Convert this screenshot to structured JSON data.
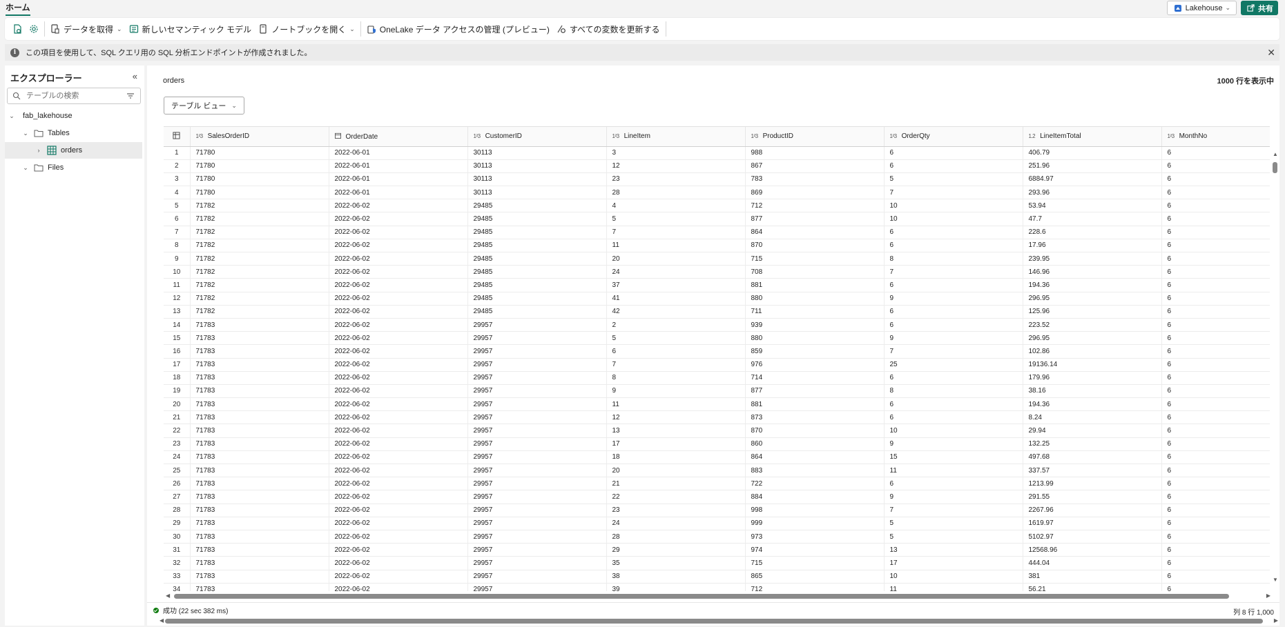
{
  "topbar": {
    "home_tab": "ホーム",
    "lakehouse_label": "Lakehouse",
    "share_label": "共有"
  },
  "ribbon": {
    "get_data": "データを取得",
    "new_semantic_model": "新しいセマンティック モデル",
    "open_notebook": "ノートブックを開く",
    "onelake_access": "OneLake データ アクセスの管理 (プレビュー)",
    "refresh_variables": "すべての変数を更新する"
  },
  "infobar": {
    "message": "この項目を使用して、SQL クエリ用の SQL 分析エンドポイントが作成されました。"
  },
  "explorer": {
    "title": "エクスプローラー",
    "search_placeholder": "テーブルの検索",
    "lakehouse": "fab_lakehouse",
    "tables_folder": "Tables",
    "table": "orders",
    "files_folder": "Files"
  },
  "main": {
    "table_name": "orders",
    "row_count": "1000 行を表示中",
    "view_button": "テーブル ビュー",
    "columns": [
      {
        "type": "1²3",
        "name": "SalesOrderID"
      },
      {
        "type": "date",
        "name": "OrderDate"
      },
      {
        "type": "1²3",
        "name": "CustomerID"
      },
      {
        "type": "1²3",
        "name": "LineItem"
      },
      {
        "type": "1²3",
        "name": "ProductID"
      },
      {
        "type": "1²3",
        "name": "OrderQty"
      },
      {
        "type": "1.2",
        "name": "LineItemTotal"
      },
      {
        "type": "1²3",
        "name": "MonthNo"
      }
    ],
    "rows": [
      [
        "1",
        "71780",
        "2022-06-01",
        "30113",
        "3",
        "988",
        "6",
        "406.79",
        "6"
      ],
      [
        "2",
        "71780",
        "2022-06-01",
        "30113",
        "12",
        "867",
        "6",
        "251.96",
        "6"
      ],
      [
        "3",
        "71780",
        "2022-06-01",
        "30113",
        "23",
        "783",
        "5",
        "6884.97",
        "6"
      ],
      [
        "4",
        "71780",
        "2022-06-01",
        "30113",
        "28",
        "869",
        "7",
        "293.96",
        "6"
      ],
      [
        "5",
        "71782",
        "2022-06-02",
        "29485",
        "4",
        "712",
        "10",
        "53.94",
        "6"
      ],
      [
        "6",
        "71782",
        "2022-06-02",
        "29485",
        "5",
        "877",
        "10",
        "47.7",
        "6"
      ],
      [
        "7",
        "71782",
        "2022-06-02",
        "29485",
        "7",
        "864",
        "6",
        "228.6",
        "6"
      ],
      [
        "8",
        "71782",
        "2022-06-02",
        "29485",
        "11",
        "870",
        "6",
        "17.96",
        "6"
      ],
      [
        "9",
        "71782",
        "2022-06-02",
        "29485",
        "20",
        "715",
        "8",
        "239.95",
        "6"
      ],
      [
        "10",
        "71782",
        "2022-06-02",
        "29485",
        "24",
        "708",
        "7",
        "146.96",
        "6"
      ],
      [
        "11",
        "71782",
        "2022-06-02",
        "29485",
        "37",
        "881",
        "6",
        "194.36",
        "6"
      ],
      [
        "12",
        "71782",
        "2022-06-02",
        "29485",
        "41",
        "880",
        "9",
        "296.95",
        "6"
      ],
      [
        "13",
        "71782",
        "2022-06-02",
        "29485",
        "42",
        "711",
        "6",
        "125.96",
        "6"
      ],
      [
        "14",
        "71783",
        "2022-06-02",
        "29957",
        "2",
        "939",
        "6",
        "223.52",
        "6"
      ],
      [
        "15",
        "71783",
        "2022-06-02",
        "29957",
        "5",
        "880",
        "9",
        "296.95",
        "6"
      ],
      [
        "16",
        "71783",
        "2022-06-02",
        "29957",
        "6",
        "859",
        "7",
        "102.86",
        "6"
      ],
      [
        "17",
        "71783",
        "2022-06-02",
        "29957",
        "7",
        "976",
        "25",
        "19136.14",
        "6"
      ],
      [
        "18",
        "71783",
        "2022-06-02",
        "29957",
        "8",
        "714",
        "6",
        "179.96",
        "6"
      ],
      [
        "19",
        "71783",
        "2022-06-02",
        "29957",
        "9",
        "877",
        "8",
        "38.16",
        "6"
      ],
      [
        "20",
        "71783",
        "2022-06-02",
        "29957",
        "11",
        "881",
        "6",
        "194.36",
        "6"
      ],
      [
        "21",
        "71783",
        "2022-06-02",
        "29957",
        "12",
        "873",
        "6",
        "8.24",
        "6"
      ],
      [
        "22",
        "71783",
        "2022-06-02",
        "29957",
        "13",
        "870",
        "10",
        "29.94",
        "6"
      ],
      [
        "23",
        "71783",
        "2022-06-02",
        "29957",
        "17",
        "860",
        "9",
        "132.25",
        "6"
      ],
      [
        "24",
        "71783",
        "2022-06-02",
        "29957",
        "18",
        "864",
        "15",
        "497.68",
        "6"
      ],
      [
        "25",
        "71783",
        "2022-06-02",
        "29957",
        "20",
        "883",
        "11",
        "337.57",
        "6"
      ],
      [
        "26",
        "71783",
        "2022-06-02",
        "29957",
        "21",
        "722",
        "6",
        "1213.99",
        "6"
      ],
      [
        "27",
        "71783",
        "2022-06-02",
        "29957",
        "22",
        "884",
        "9",
        "291.55",
        "6"
      ],
      [
        "28",
        "71783",
        "2022-06-02",
        "29957",
        "23",
        "998",
        "7",
        "2267.96",
        "6"
      ],
      [
        "29",
        "71783",
        "2022-06-02",
        "29957",
        "24",
        "999",
        "5",
        "1619.97",
        "6"
      ],
      [
        "30",
        "71783",
        "2022-06-02",
        "29957",
        "28",
        "973",
        "5",
        "5102.97",
        "6"
      ],
      [
        "31",
        "71783",
        "2022-06-02",
        "29957",
        "29",
        "974",
        "13",
        "12568.96",
        "6"
      ],
      [
        "32",
        "71783",
        "2022-06-02",
        "29957",
        "35",
        "715",
        "17",
        "444.04",
        "6"
      ],
      [
        "33",
        "71783",
        "2022-06-02",
        "29957",
        "38",
        "865",
        "10",
        "381",
        "6"
      ],
      [
        "34",
        "71783",
        "2022-06-02",
        "29957",
        "39",
        "712",
        "11",
        "56.21",
        "6"
      ]
    ]
  },
  "status": {
    "message": "成功 (22 sec 382 ms)",
    "summary": "列 8 行 1,000"
  },
  "colors": {
    "accent": "#117865",
    "success": "#107c10"
  }
}
